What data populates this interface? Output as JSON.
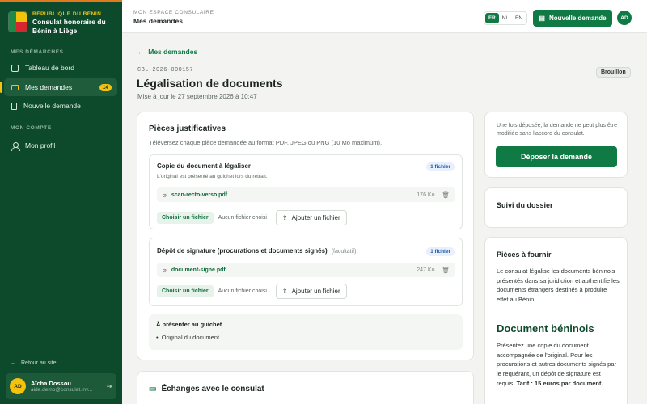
{
  "sidebar": {
    "brand_kicker": "RÉPUBLIQUE DU BÉNIN",
    "brand_name_1": "Consulat honoraire du",
    "brand_name_2": "Bénin à Liège",
    "section_demarches": "MES DÉMARCHES",
    "items": [
      {
        "label": "Tableau de bord",
        "icon": "grid-icon"
      },
      {
        "label": "Mes demandes",
        "icon": "folder-icon",
        "badge": "14",
        "active": true
      },
      {
        "label": "Nouvelle demande",
        "icon": "document-plus-icon"
      }
    ],
    "section_compte": "MON COMPTE",
    "profile_label": "Mon profil",
    "back_site": "Retour au site",
    "user": {
      "initials": "AD",
      "name": "Aïcha Dossou",
      "email": "aide.demo@consulat.inv..."
    }
  },
  "topbar": {
    "kicker": "MON ESPACE CONSULAIRE",
    "title": "Mes demandes",
    "languages": [
      "FR",
      "NL",
      "EN"
    ],
    "active_language": "FR",
    "new_request": "Nouvelle demande",
    "avatar": "AD"
  },
  "page": {
    "breadcrumb": "Mes demandes",
    "reference": "CBL-2026-000157",
    "status": "Brouillon",
    "title": "Légalisation de documents",
    "updated": "Mise à jour le 27 septembre 2026 à 10:47"
  },
  "pieces": {
    "title": "Pièces justificatives",
    "subtitle": "Téléversez chaque pièce demandée au format PDF, JPEG ou PNG (10 Mo maximum).",
    "items": [
      {
        "title": "Copie du document à légaliser",
        "optional": "",
        "desc": "L'original est présenté au guichet lors du retrait.",
        "badge": "1 fichier",
        "file_name": "scan-recto-verso.pdf",
        "file_size": "176 Ko",
        "choose": "Choisir un fichier",
        "no_file": "Aucun fichier choisi",
        "add": "Ajouter un fichier"
      },
      {
        "title": "Dépôt de signature (procurations et documents signés)",
        "optional": "(facultatif)",
        "desc": "",
        "badge": "1 fichier",
        "file_name": "document-signe.pdf",
        "file_size": "247 Ko",
        "choose": "Choisir un fichier",
        "no_file": "Aucun fichier choisi",
        "add": "Ajouter un fichier"
      }
    ],
    "guichet_title": "À présenter au guichet",
    "guichet_item": "Original du document"
  },
  "exchanges": {
    "title": "Échanges avec le consulat"
  },
  "submit": {
    "note": "Une fois déposée, la demande ne peut plus être modifiée sans l'accord du consulat.",
    "button": "Déposer la demande"
  },
  "suivi": {
    "title": "Suivi du dossier"
  },
  "pieces_a_fournir": {
    "title": "Pièces à fournir",
    "intro": "Le consulat légalise les documents béninois présentés dans sa juridiction et authentifie les documents étrangers destinés à produire effet au Bénin.",
    "heading": "Document béninois",
    "text": "Présentez une copie du document accompagnée de l'original. Pour les procurations et autres documents signés par le requérant, un dépôt de signature est requis.",
    "tarif": "Tarif : 15 euros par document."
  },
  "colors": {
    "sidebar": "#0d4a2c",
    "accent": "#0f7a43",
    "flag_green": "#1f8a45",
    "flag_yellow": "#f2c20d",
    "flag_red": "#d6262f",
    "top_stripe": "#e07a1f"
  }
}
